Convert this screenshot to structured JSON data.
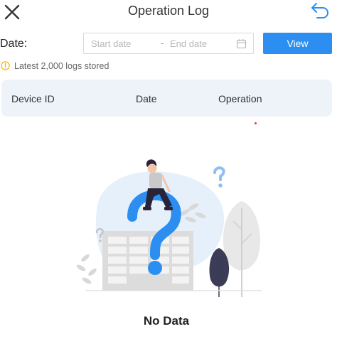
{
  "header": {
    "title": "Operation Log"
  },
  "filter": {
    "date_label": "Date:",
    "start_placeholder": "Start date",
    "separator": "-",
    "end_placeholder": "End date",
    "view_label": "View"
  },
  "notice": {
    "text": "Latest 2,000 logs stored"
  },
  "table": {
    "columns": [
      "Device ID",
      "Date",
      "Operation"
    ]
  },
  "empty": {
    "text": "No Data"
  },
  "colors": {
    "accent": "#2b8ef0",
    "table_header_bg": "#eef3fa",
    "question_mark": "#2b8ef0",
    "warning": "#f5b400"
  },
  "icons": {
    "close": "close-icon",
    "back": "undo-arrow-icon",
    "calendar": "calendar-icon",
    "info": "info-circle-icon"
  }
}
